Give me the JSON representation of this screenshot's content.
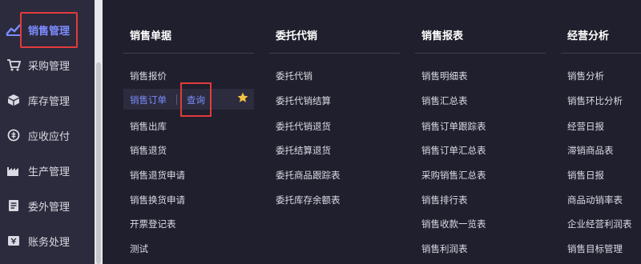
{
  "sidebar": {
    "items": [
      {
        "label": "销售管理",
        "icon": "sales-chart-icon",
        "active": true
      },
      {
        "label": "采购管理",
        "icon": "shopping-cart-icon"
      },
      {
        "label": "库存管理",
        "icon": "inventory-box-icon"
      },
      {
        "label": "应收应付",
        "icon": "receivable-payable-icon"
      },
      {
        "label": "生产管理",
        "icon": "factory-icon"
      },
      {
        "label": "委外管理",
        "icon": "outsourcing-icon"
      },
      {
        "label": "账务处理",
        "icon": "accounting-icon"
      }
    ]
  },
  "menu": {
    "columns": [
      {
        "title": "销售单据",
        "items": [
          "销售报价",
          "销售订单",
          "销售出库",
          "销售退货",
          "销售退货申请",
          "销售换货申请",
          "开票登记表",
          "测试"
        ]
      },
      {
        "title": "委托代销",
        "items": [
          "委托代销",
          "委托代销结算",
          "委托代销退货",
          "委托结算退货",
          "委托商品跟踪表",
          "委托库存余额表"
        ]
      },
      {
        "title": "销售报表",
        "items": [
          "销售明细表",
          "销售汇总表",
          "销售订单跟踪表",
          "销售订单汇总表",
          "采购销售汇总表",
          "销售排行表",
          "销售收款一览表",
          "销售利润表"
        ]
      },
      {
        "title": "经营分析",
        "items": [
          "销售分析",
          "销售环比分析",
          "经营日报",
          "滞销商品表",
          "销售日报",
          "商品动销率表",
          "企业经营利润表",
          "销售目标管理"
        ]
      }
    ],
    "hover_row": {
      "label": "销售订单",
      "action": "查询",
      "star_icon": "star-icon"
    }
  },
  "colors": {
    "accent": "#7d8cff",
    "background": "#1f1f2d",
    "sidebar": "#2b2b3d",
    "highlight_box": "#e23b3b",
    "star": "#f5c242"
  }
}
